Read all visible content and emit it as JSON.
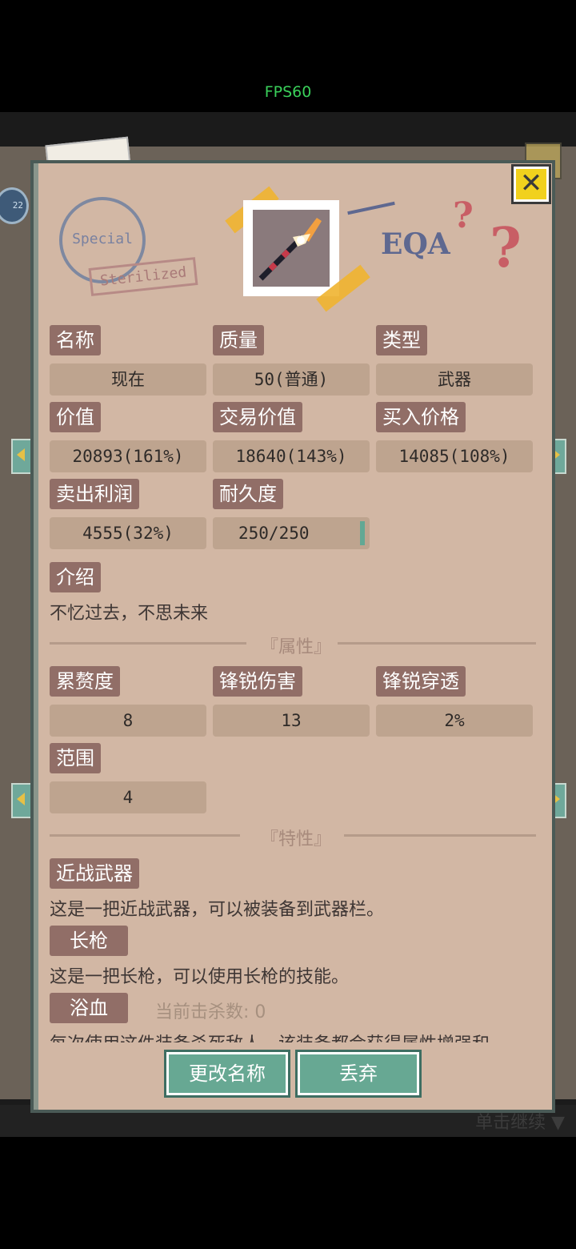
{
  "status": {
    "fps": "FPS60"
  },
  "background": {
    "hint": "单击继续",
    "avatar_level": "22"
  },
  "item": {
    "icon": "spear-icon",
    "stamp_text": "Special",
    "stamp_label": "Sterilized",
    "brand": "EQA",
    "fields": {
      "name": {
        "label": "名称",
        "value": "现在"
      },
      "quality": {
        "label": "质量",
        "value": "50(普通)"
      },
      "type": {
        "label": "类型",
        "value": "武器"
      },
      "value": {
        "label": "价值",
        "value": "20893(161%)"
      },
      "trade": {
        "label": "交易价值",
        "value": "18640(143%)"
      },
      "buy": {
        "label": "买入价格",
        "value": "14085(108%)"
      },
      "profit": {
        "label": "卖出利润",
        "value": "4555(32%)"
      },
      "durability": {
        "label": "耐久度",
        "value": "250/250",
        "fraction": 1.0
      }
    },
    "intro": {
      "label": "介绍",
      "text": "不忆过去，不思未来"
    }
  },
  "attributes": {
    "title": "『属性』",
    "items": [
      {
        "label": "累赘度",
        "value": "8"
      },
      {
        "label": "锋锐伤害",
        "value": "13"
      },
      {
        "label": "锋锐穿透",
        "value": "2%"
      },
      {
        "label": "范围",
        "value": "4"
      }
    ]
  },
  "traits": {
    "title": "『特性』",
    "items": [
      {
        "label": "近战武器",
        "text": "这是一把近战武器，可以被装备到武器栏。"
      },
      {
        "label": "长枪",
        "text": "这是一把长枪，可以使用长枪的技能。"
      },
      {
        "label": "浴血",
        "counter": "当前击杀数: 0",
        "text": "每次使用这件装备杀死敌人，该装备都会获得属性增强和"
      }
    ]
  },
  "buttons": {
    "rename": "更改名称",
    "discard": "丢弃",
    "close": "✕"
  },
  "colors": {
    "accent": "#67a893",
    "label_bg": "#916e67",
    "panel_bg": "#d2b7a4",
    "close": "#f1d11d"
  }
}
